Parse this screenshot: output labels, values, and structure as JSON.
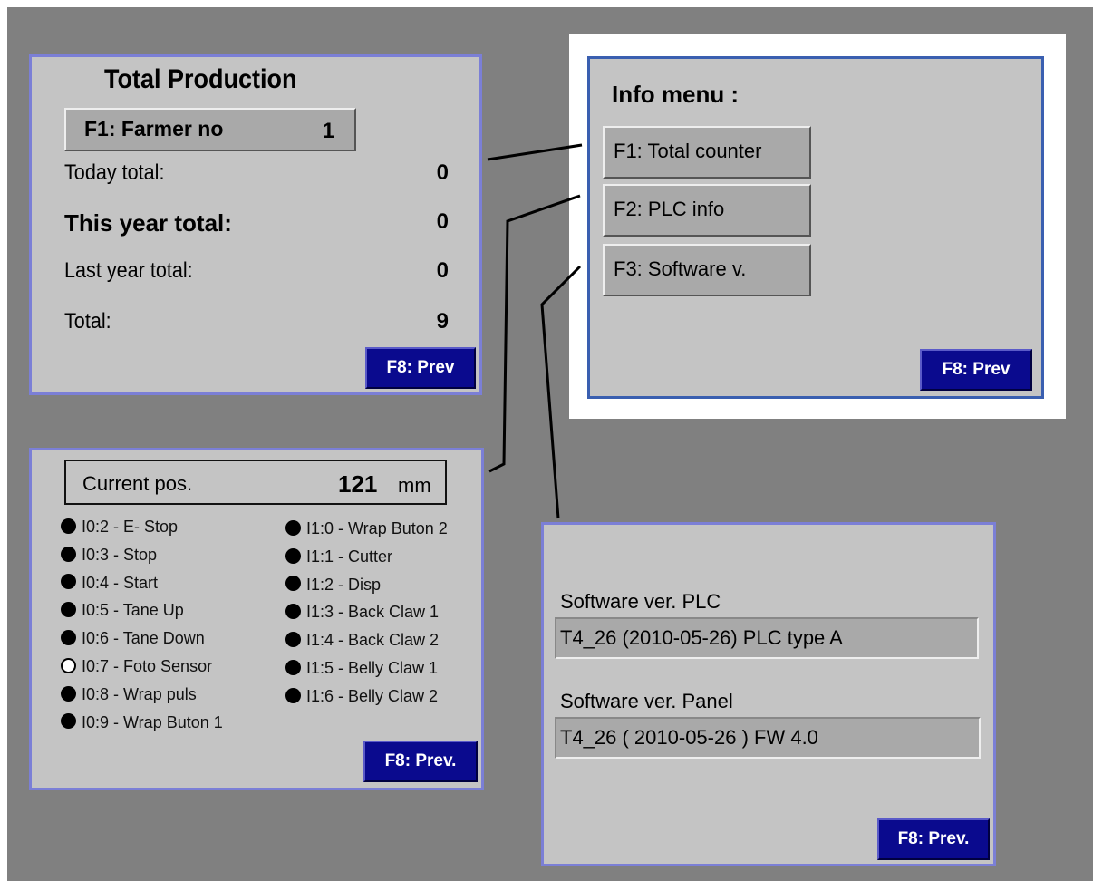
{
  "total_production": {
    "title": "Total Production",
    "farmer_button_label": "F1: Farmer no",
    "farmer_no": "1",
    "rows": [
      {
        "label": "Today total:",
        "value": "0"
      },
      {
        "label": "This year total:",
        "value": "0"
      },
      {
        "label": "Last year total:",
        "value": "0"
      },
      {
        "label": "Total:",
        "value": "9"
      }
    ],
    "prev_label": "F8: Prev"
  },
  "info_menu": {
    "title": "Info menu :",
    "items": [
      {
        "label": "F1: Total counter"
      },
      {
        "label": "F2: PLC info"
      },
      {
        "label": "F3: Software v."
      }
    ],
    "prev_label": "F8: Prev"
  },
  "plc_info": {
    "current_pos_label": "Current pos.",
    "current_pos_value": "121",
    "current_pos_unit": "mm",
    "inputs_left": [
      {
        "label": "I0:2 - E- Stop",
        "state": "on"
      },
      {
        "label": "I0:3 - Stop",
        "state": "on"
      },
      {
        "label": "I0:4 - Start",
        "state": "on"
      },
      {
        "label": "I0:5 - Tane Up",
        "state": "on"
      },
      {
        "label": "I0:6 - Tane Down",
        "state": "on"
      },
      {
        "label": "I0:7 - Foto Sensor",
        "state": "off"
      },
      {
        "label": "I0:8 - Wrap puls",
        "state": "on"
      },
      {
        "label": "I0:9 - Wrap Buton 1",
        "state": "on"
      }
    ],
    "inputs_right": [
      {
        "label": "I1:0 - Wrap Buton 2",
        "state": "on"
      },
      {
        "label": "I1:1 - Cutter",
        "state": "on"
      },
      {
        "label": "I1:2 - Disp",
        "state": "on"
      },
      {
        "label": "I1:3 - Back Claw 1",
        "state": "on"
      },
      {
        "label": "I1:4 - Back Claw 2",
        "state": "on"
      },
      {
        "label": "I1:5 - Belly Claw 1",
        "state": "on"
      },
      {
        "label": "I1:6 - Belly Claw 2",
        "state": "on"
      }
    ],
    "prev_label": "F8: Prev."
  },
  "software": {
    "plc_label": "Software ver. PLC",
    "plc_value": "T4_26 (2010-05-26) PLC type A",
    "panel_label": "Software ver. Panel",
    "panel_value": "T4_26 ( 2010-05-26 ) FW 4.0",
    "prev_label": "F8: Prev."
  },
  "colors": {
    "background": "#808080",
    "panel": "#c4c4c4",
    "panel_border": "#7b7fd6",
    "prev_button": "#0a0a8e"
  }
}
